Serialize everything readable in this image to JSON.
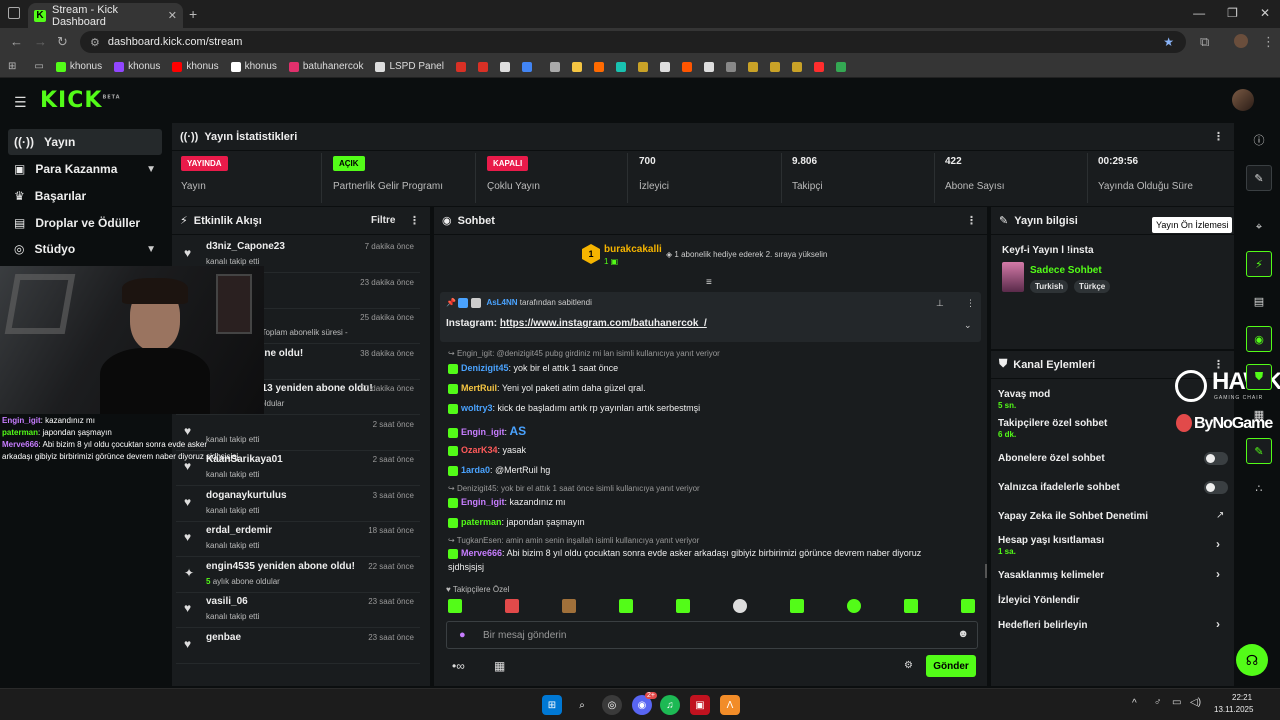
{
  "browser": {
    "tab_title": "Stream - Kick Dashboard",
    "url": "dashboard.kick.com/stream",
    "bookmarks": [
      {
        "label": "khonus",
        "color": "#53fc18"
      },
      {
        "label": "khonus",
        "color": "#9146ff"
      },
      {
        "label": "khonus",
        "color": "#ff0000"
      },
      {
        "label": "khonus",
        "color": "#ffffff"
      },
      {
        "label": "batuhanercok",
        "color": "#e1306c"
      },
      {
        "label": "LSPD Panel",
        "color": "#ffffff"
      }
    ]
  },
  "header": {
    "logo": "KICK",
    "logo_sup": "BETA"
  },
  "sidebar": {
    "items": [
      {
        "label": "Yayın",
        "icon": "broadcast-icon"
      },
      {
        "label": "Para Kazanma",
        "icon": "money-icon"
      },
      {
        "label": "Başarılar",
        "icon": "trophy-icon"
      },
      {
        "label": "Droplar ve Ödüller",
        "icon": "gift-icon"
      },
      {
        "label": "Stüdyo",
        "icon": "studio-icon"
      }
    ]
  },
  "stats": {
    "title": "Yayın İstatistikleri",
    "items": [
      {
        "badge": "YAYINDA",
        "label": "Yayın",
        "badge_color": "#e91b4a"
      },
      {
        "badge": "AÇIK",
        "label": "Partnerlik Gelir Programı",
        "badge_color": "#53fc18"
      },
      {
        "badge": "KAPALI",
        "label": "Çoklu Yayın",
        "badge_color": "#e91b4a"
      },
      {
        "value": "700",
        "label": "İzleyici"
      },
      {
        "value": "9.806",
        "label": "Takipçi"
      },
      {
        "value": "422",
        "label": "Abone Sayısı"
      },
      {
        "value": "00:29:56",
        "label": "Yayında Olduğu Süre"
      }
    ]
  },
  "activity": {
    "title": "Etkinlik Akışı",
    "filter": "Filtre",
    "items": [
      {
        "name": "d3niz_Capone23",
        "sub": "kanalı takip etti",
        "time": "7 dakika önce",
        "icon": "heart-icon"
      },
      {
        "name": "",
        "sub": "",
        "time": "23 dakika önce",
        "icon": ""
      },
      {
        "name": "",
        "sub": "nesini kutluyor! Toplam abonelik süresi -",
        "time": "25 dakika önce",
        "icon": ""
      },
      {
        "name": "yeniden abone oldu!",
        "sub": "oldular",
        "time": "38 dakika önce",
        "icon": ""
      },
      {
        "name": "Ekin_Boran13 yeniden abone oldu!",
        "sub_num": "10",
        "sub": "aylık abone oldular",
        "time": "50 dakika önce",
        "icon": "sparkle-icon"
      },
      {
        "name": "",
        "sub": "kanalı takip etti",
        "time": "2 saat önce",
        "icon": "heart-icon"
      },
      {
        "name": "KaanSarikaya01",
        "sub": "kanalı takip etti",
        "time": "2 saat önce",
        "icon": "heart-icon"
      },
      {
        "name": "doganaykurtulus",
        "sub": "kanalı takip etti",
        "time": "3 saat önce",
        "icon": "heart-icon"
      },
      {
        "name": "erdal_erdemir",
        "sub": "kanalı takip etti",
        "time": "18 saat önce",
        "icon": "heart-icon"
      },
      {
        "name": "engin4535 yeniden abone oldu!",
        "sub_num": "5",
        "sub": "aylık abone oldular",
        "time": "22 saat önce",
        "icon": "sparkle-icon"
      },
      {
        "name": "vasili_06",
        "sub": "kanalı takip etti",
        "time": "23 saat önce",
        "icon": "heart-icon"
      },
      {
        "name": "genbae",
        "sub": "",
        "time": "23 saat önce",
        "icon": "heart-icon"
      }
    ]
  },
  "cam_chat": [
    {
      "user": "Engin_igit",
      "msg": ": kazandınız mı",
      "color": "#c77dff"
    },
    {
      "user": "paterman",
      "msg": ": japondan şaşmayın",
      "color": "#53fc18"
    },
    {
      "user": "Merve666",
      "msg": ": Abi bizim 8 yıl oldu çocuktan sonra evde asker",
      "color": "#c77dff"
    },
    {
      "user": "",
      "msg": "arkadaşı gibiyiz birbirimizi görünce devrem naber diyoruz sjdhsjsjsj",
      "color": "#ffffff"
    }
  ],
  "chat": {
    "title": "Sohbet",
    "top_gifter": {
      "name": "burakcakalli",
      "count": "1",
      "rank": "1"
    },
    "gift_prompt": "1 abonelik hediye ederek 2. sıraya yükselin",
    "pinned": {
      "by_user": "AsL4NN",
      "by_text": "tarafından sabitlendi",
      "text": "Instagram:",
      "link": "https://www.instagram.com/batuhanercok_/"
    },
    "messages": [
      {
        "reply": "Engin_igit: @denizigit45 pubg girdiniz mi lan isimli kullanıcıya yanıt veriyor"
      },
      {
        "user": "Denizigit45",
        "text": "yok bir el attık 1 saat önce",
        "color": "#4aa3ff"
      },
      {
        "user": "MertRuil",
        "text": "Yeni yol paketi atim daha güzel qral.",
        "color": "#f5c542"
      },
      {
        "user": "woltry3",
        "text": "kick de başladımı artık rp yayınları artık serbestmşi",
        "color": "#4aa3ff"
      },
      {
        "user": "Engin_igit",
        "text": "AS",
        "color": "#c77dff"
      },
      {
        "user": "OzarK34",
        "text": "yasak",
        "color": "#ff5a5a"
      },
      {
        "user": "1arda0",
        "text": "@MertRuil hg",
        "color": "#4aa3ff"
      },
      {
        "reply": "Denizigit45: yok bir el attık 1 saat önce isimli kullanıcıya yanıt veriyor"
      },
      {
        "user": "Engin_igit",
        "text": "kazandınız mı",
        "color": "#c77dff"
      },
      {
        "user": "paterman",
        "text": "japondan şaşmayın",
        "color": "#53fc18"
      },
      {
        "reply": "TugkanEsen: amin amin senin inşallah isimli kullanıcıya yanıt veriyor"
      },
      {
        "user": "Merve666",
        "text": "Abi bizim 8 yıl oldu çocuktan sonra evde asker arkadaşı gibiyiz birbirimizi görünce devrem naber diyoruz",
        "color": "#c77dff"
      },
      {
        "text": "sjdhsjsjsj",
        "color": "#eeeeee"
      }
    ],
    "followers_only": "Takipçilere Özel",
    "input_placeholder": "Bir mesaj gönderin",
    "send": "Gönder"
  },
  "stream_info": {
    "title": "Yayın bilgisi",
    "tooltip": "Yayın Ön İzlemesi",
    "stream_title": "Keyf-i Yayın l !insta",
    "category": "Sadece Sohbet",
    "tags": [
      "Turkish",
      "Türkçe"
    ]
  },
  "channel_actions": {
    "title": "Kanal Eylemleri",
    "items": [
      {
        "label": "Yavaş mod",
        "value": "5 sn."
      },
      {
        "label": "Takipçilere özel sohbet",
        "value": "6 dk."
      },
      {
        "label": "Abonelere özel sohbet",
        "toggle": "off"
      },
      {
        "label": "Yalnızca ifadelerle sohbet",
        "toggle": "off"
      },
      {
        "label": "Yapay Zeka ile Sohbet Denetimi"
      },
      {
        "label": "Hesap yaşı kısıtlaması",
        "value": "1 sa."
      },
      {
        "label": "Yasaklanmış kelimeler"
      },
      {
        "label": "İzleyici Yönlendir"
      },
      {
        "label": "Hedefleri belirleyin"
      }
    ]
  },
  "overlay": {
    "hawk": "HAWK",
    "hawk_sub": "GAMING CHAIR",
    "bynogame": "ByNoGame"
  },
  "taskbar": {
    "time": "22:21",
    "date": "13.11.2025",
    "discord_badge": "2+"
  }
}
